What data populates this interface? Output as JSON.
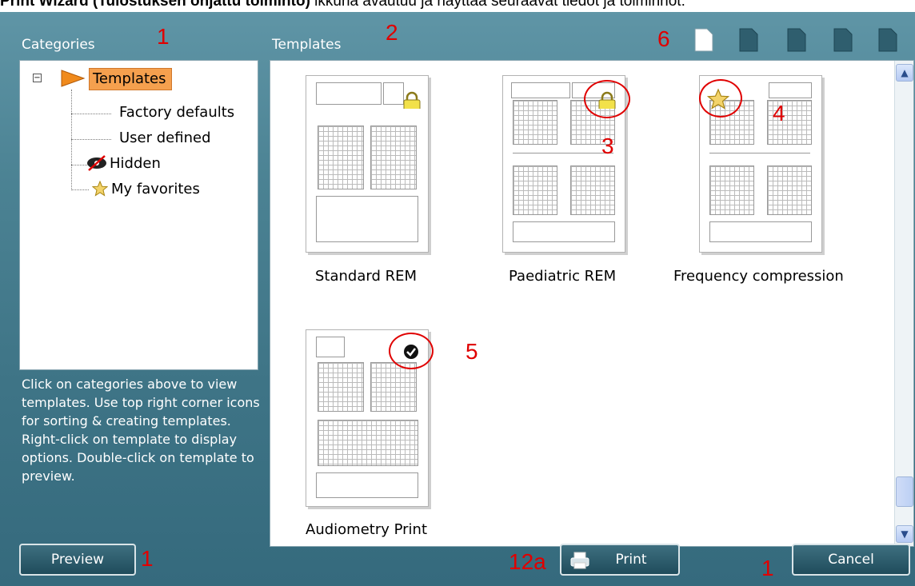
{
  "doc": {
    "bold_text": "Print Wizard (Tulostuksen ohjattu toiminto)",
    "rest_text": " ikkuna avautuu ja näyttää seuraavat tiedot ja toiminnot:"
  },
  "categories": {
    "label": "Categories",
    "tree": [
      {
        "label": "Templates",
        "icon": "arrow-icon",
        "selected": true
      },
      {
        "label": "Factory defaults"
      },
      {
        "label": "User defined"
      },
      {
        "label": "Hidden",
        "icon": "hidden-eye-icon"
      },
      {
        "label": "My favorites",
        "icon": "star-icon"
      }
    ],
    "hint": "Click on categories above to view templates. Use top right corner icons for sorting & creating templates. Right-click on template to display options. Double-click on template to preview."
  },
  "templates": {
    "label": "Templates",
    "items": [
      {
        "name": "Standard REM",
        "badge": "lock-icon"
      },
      {
        "name": "Paediatric REM",
        "badge": "lock-icon"
      },
      {
        "name": "Frequency compression",
        "badge": "star-icon"
      },
      {
        "name": "Audiometry Print",
        "badge": "check-icon"
      }
    ]
  },
  "annotations": {
    "categories": "1",
    "templates": "2",
    "lock": "3",
    "star": "4",
    "check": "5",
    "toolbar": "6",
    "preview": "1",
    "print": "12a",
    "cancel": "1"
  },
  "buttons": {
    "preview": "Preview",
    "print": "Print",
    "cancel": "Cancel"
  },
  "colors": {
    "accent_selection": "#f5a04e",
    "annotation_red": "#e00000",
    "window_teal": "#4b8293"
  }
}
